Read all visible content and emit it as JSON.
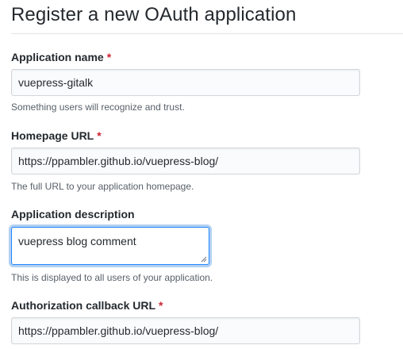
{
  "page": {
    "title": "Register a new OAuth application"
  },
  "fields": {
    "app_name": {
      "label": "Application name",
      "required_mark": "*",
      "value": "vuepress-gitalk",
      "note": "Something users will recognize and trust."
    },
    "homepage_url": {
      "label": "Homepage URL",
      "required_mark": "*",
      "value": "https://ppambler.github.io/vuepress-blog/",
      "note": "The full URL to your application homepage."
    },
    "description": {
      "label": "Application description",
      "value": "vuepress blog comment",
      "note": "This is displayed to all users of your application."
    },
    "callback_url": {
      "label": "Authorization callback URL",
      "required_mark": "*",
      "value": "https://ppambler.github.io/vuepress-blog/"
    }
  },
  "colors": {
    "required": "#cb2431",
    "focus_border": "#2188ff",
    "note_text": "#586069"
  }
}
